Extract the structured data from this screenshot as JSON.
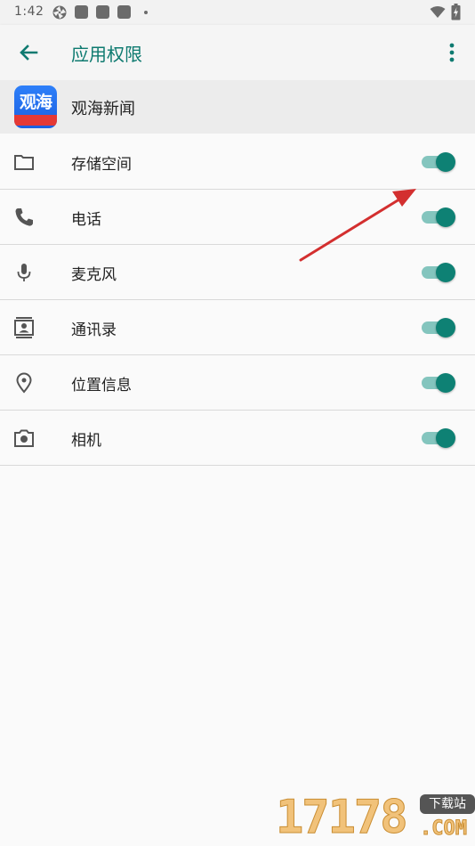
{
  "status_bar": {
    "time": "1:42"
  },
  "app_bar": {
    "title": "应用权限"
  },
  "app": {
    "name": "观海新闻",
    "icon_text": "观海"
  },
  "permissions": [
    {
      "label": "存储空间",
      "icon": "folder-icon",
      "enabled": true
    },
    {
      "label": "电话",
      "icon": "phone-icon",
      "enabled": true
    },
    {
      "label": "麦克风",
      "icon": "microphone-icon",
      "enabled": true
    },
    {
      "label": "通讯录",
      "icon": "contacts-icon",
      "enabled": true
    },
    {
      "label": "位置信息",
      "icon": "location-icon",
      "enabled": true
    },
    {
      "label": "相机",
      "icon": "camera-icon",
      "enabled": true
    }
  ],
  "colors": {
    "accent": "#0e7a70",
    "switch_on_track": "#84c5be",
    "switch_on_thumb": "#0e8174",
    "annotation_arrow": "#d32f2f"
  },
  "watermark": {
    "number": "17178",
    "badge": "下载站",
    "suffix": ".COM"
  }
}
